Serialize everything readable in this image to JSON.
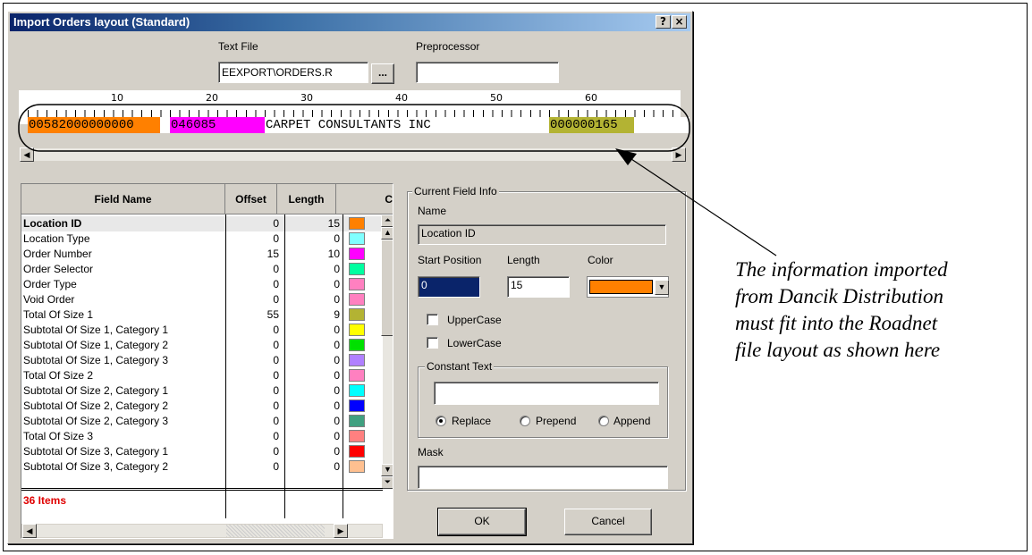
{
  "window": {
    "title": "Import Orders layout (Standard)",
    "help_label": "?",
    "close_label": "×"
  },
  "file": {
    "text_file_label": "Text File",
    "text_file_value": "EEXPORT\\ORDERS.R",
    "browse_label": "...",
    "preprocessor_label": "Preprocessor",
    "preprocessor_value": ""
  },
  "ruler": {
    "ticks": [
      "10",
      "20",
      "30",
      "40",
      "50",
      "60"
    ],
    "segments": [
      {
        "text": "00582000000000",
        "color": "#ff8000"
      },
      {
        "text": "046085",
        "color": "#ff00ff"
      },
      {
        "text": "CARPET CONSULTANTS INC",
        "color": "#ffffff"
      },
      {
        "text": "000000165",
        "color": "#b3b333"
      }
    ]
  },
  "grid": {
    "headers": {
      "field_name": "Field Name",
      "offset": "Offset",
      "length": "Length",
      "color": "C"
    },
    "rows": [
      {
        "name": "Location ID",
        "offset": "0",
        "length": "15",
        "color": "#ff8000",
        "selected": true
      },
      {
        "name": "Location Type",
        "offset": "0",
        "length": "0",
        "color": "#80ffff"
      },
      {
        "name": "Order Number",
        "offset": "15",
        "length": "10",
        "color": "#ff00ff"
      },
      {
        "name": "Order Selector",
        "offset": "0",
        "length": "0",
        "color": "#00ffa0"
      },
      {
        "name": "Order Type",
        "offset": "0",
        "length": "0",
        "color": "#ff80c0"
      },
      {
        "name": "Void Order",
        "offset": "0",
        "length": "0",
        "color": "#ff80c0"
      },
      {
        "name": "Total Of Size 1",
        "offset": "55",
        "length": "9",
        "color": "#b3b333"
      },
      {
        "name": "Subtotal Of Size 1, Category 1",
        "offset": "0",
        "length": "0",
        "color": "#ffff00"
      },
      {
        "name": "Subtotal Of Size 1, Category 2",
        "offset": "0",
        "length": "0",
        "color": "#00e000"
      },
      {
        "name": "Subtotal Of Size 1, Category 3",
        "offset": "0",
        "length": "0",
        "color": "#b080ff"
      },
      {
        "name": "Total Of Size 2",
        "offset": "0",
        "length": "0",
        "color": "#ff80c0"
      },
      {
        "name": "Subtotal Of Size 2, Category 1",
        "offset": "0",
        "length": "0",
        "color": "#00ffff"
      },
      {
        "name": "Subtotal Of Size 2, Category 2",
        "offset": "0",
        "length": "0",
        "color": "#0000ff"
      },
      {
        "name": "Subtotal Of Size 2, Category 3",
        "offset": "0",
        "length": "0",
        "color": "#40a080"
      },
      {
        "name": "Total Of Size 3",
        "offset": "0",
        "length": "0",
        "color": "#ff8080"
      },
      {
        "name": "Subtotal Of Size 3, Category 1",
        "offset": "0",
        "length": "0",
        "color": "#ff0000"
      },
      {
        "name": "Subtotal Of Size 3, Category 2",
        "offset": "0",
        "length": "0",
        "color": "#ffc090"
      }
    ],
    "item_count": "36 Items"
  },
  "field_info": {
    "group_title": "Current Field Info",
    "name_label": "Name",
    "name_value": "Location ID",
    "start_label": "Start Position",
    "start_value": "0",
    "length_label": "Length",
    "length_value": "15",
    "color_label": "Color",
    "color_value": "#ff8000",
    "uppercase_label": "UpperCase",
    "lowercase_label": "LowerCase",
    "constant_title": "Constant Text",
    "constant_value": "",
    "replace_label": "Replace",
    "prepend_label": "Prepend",
    "append_label": "Append",
    "mask_label": "Mask",
    "mask_value": ""
  },
  "buttons": {
    "ok_label": "OK",
    "cancel_label": "Cancel"
  },
  "annotation": {
    "line1": "The information imported",
    "line2": "from Dancik Distribution",
    "line3": "must fit into the Roadnet",
    "line4": "file layout as shown here"
  }
}
